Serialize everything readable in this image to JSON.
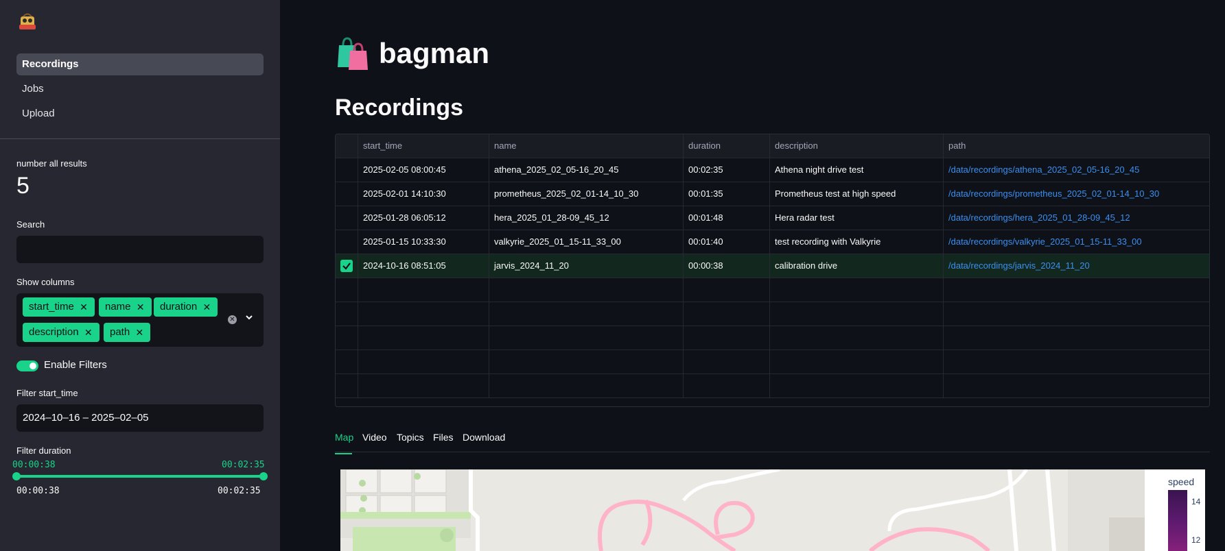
{
  "sidebar": {
    "logo_alt": "BAGMAN",
    "nav": [
      {
        "label": "Recordings",
        "active": true
      },
      {
        "label": "Jobs",
        "active": false
      },
      {
        "label": "Upload",
        "active": false
      }
    ],
    "metric_label": "number all results",
    "metric_value": "5",
    "search_label": "Search",
    "search_value": "",
    "columns_label": "Show columns",
    "columns": [
      "start_time",
      "name",
      "duration",
      "description",
      "path"
    ],
    "filters_toggle_label": "Enable Filters",
    "filters_enabled": true,
    "start_time_label": "Filter start_time",
    "start_time_value": "2024–10–16 – 2025–02–05",
    "duration_label": "Filter duration",
    "duration_low": "00:00:38",
    "duration_high": "00:02:35",
    "duration_min": "00:00:38",
    "duration_max": "00:02:35"
  },
  "main": {
    "app_title": "bagman",
    "app_icon": "shopping-bags-icon",
    "section_title": "Recordings",
    "table": {
      "headers": [
        "start_time",
        "name",
        "duration",
        "description",
        "path"
      ],
      "rows": [
        {
          "selected": false,
          "start_time": "2025-02-05 08:00:45",
          "name": "athena_2025_02_05-16_20_45",
          "duration": "00:02:35",
          "description": "Athena night drive test",
          "path": "/data/recordings/athena_2025_02_05-16_20_45"
        },
        {
          "selected": false,
          "start_time": "2025-02-01 14:10:30",
          "name": "prometheus_2025_02_01-14_10_30",
          "duration": "00:01:35",
          "description": "Prometheus test at high speed",
          "path": "/data/recordings/prometheus_2025_02_01-14_10_30"
        },
        {
          "selected": false,
          "start_time": "2025-01-28 06:05:12",
          "name": "hera_2025_01_28-09_45_12",
          "duration": "00:01:48",
          "description": "Hera radar test",
          "path": "/data/recordings/hera_2025_01_28-09_45_12"
        },
        {
          "selected": false,
          "start_time": "2025-01-15 10:33:30",
          "name": "valkyrie_2025_01_15-11_33_00",
          "duration": "00:01:40",
          "description": "test recording with Valkyrie",
          "path": "/data/recordings/valkyrie_2025_01_15-11_33_00"
        },
        {
          "selected": true,
          "start_time": "2024-10-16 08:51:05",
          "name": "jarvis_2024_11_20",
          "duration": "00:00:38",
          "description": "calibration drive",
          "path": "/data/recordings/jarvis_2024_11_20"
        }
      ]
    },
    "tabs": [
      {
        "label": "Map",
        "active": true
      },
      {
        "label": "Video",
        "active": false
      },
      {
        "label": "Topics",
        "active": false
      },
      {
        "label": "Files",
        "active": false
      },
      {
        "label": "Download",
        "active": false
      }
    ],
    "map": {
      "legend_title": "speed",
      "legend_ticks": [
        "14",
        "12"
      ],
      "track_color": "#ffb3c8"
    }
  },
  "colors": {
    "accent": "#19d38a",
    "link": "#3b8ff0",
    "background": "#0e1117",
    "sidebar": "#262730"
  }
}
